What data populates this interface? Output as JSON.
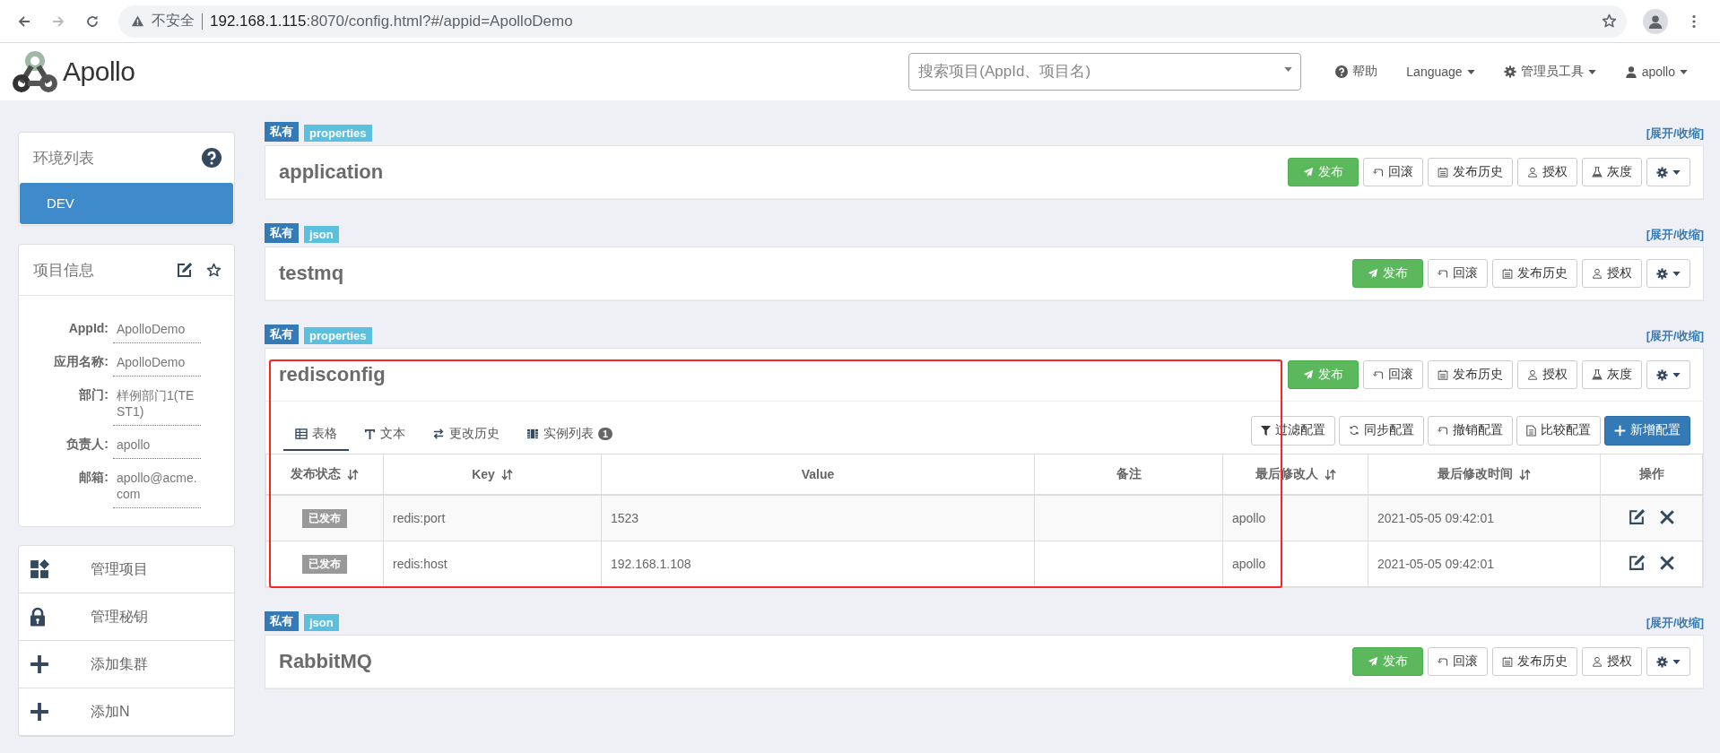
{
  "browser": {
    "warning": "不安全",
    "host": "192.168.1.115",
    "path": ":8070/config.html?#/appid=ApolloDemo"
  },
  "navbar": {
    "logo": "Apollo",
    "search": {
      "placeholder": "搜索项目(AppId、项目名)"
    },
    "links": [
      {
        "label": "帮助",
        "kind": "help",
        "caret": false
      },
      {
        "label": "Language",
        "kind": "plain",
        "caret": true
      },
      {
        "label": "管理员工具",
        "kind": "tools",
        "caret": true
      },
      {
        "label": "apollo",
        "kind": "user",
        "caret": true
      }
    ]
  },
  "sidebar": {
    "environments": {
      "title": "环境列表",
      "items": [
        {
          "label": "DEV",
          "selected": true
        }
      ]
    },
    "project": {
      "title": "项目信息",
      "fields": [
        {
          "label": "AppId:",
          "value": "ApolloDemo"
        },
        {
          "label": "应用名称:",
          "value": "ApolloDemo"
        },
        {
          "label": "部门:",
          "value": "样例部门1(TEST1)"
        },
        {
          "label": "负责人:",
          "value": "apollo"
        },
        {
          "label": "邮箱:",
          "value": "apollo@acme.com"
        }
      ]
    },
    "actions": [
      {
        "label": "管理项目",
        "kind": "manage"
      },
      {
        "label": "管理秘钥",
        "kind": "lock"
      },
      {
        "label": "添加集群",
        "kind": "add"
      },
      {
        "label": "添加N",
        "kind": "add"
      }
    ]
  },
  "namespaces": [
    {
      "tags": [
        {
          "label": "私有",
          "kind": "scope"
        },
        {
          "label": "properties",
          "kind": "format"
        }
      ],
      "toggle": "[展开/收缩]",
      "name": "application",
      "annotated": false,
      "buttons": [
        {
          "label": "发布",
          "kind": "publish"
        },
        {
          "label": "回滚",
          "kind": "rollback"
        },
        {
          "label": "发布历史",
          "kind": "history"
        },
        {
          "label": "授权",
          "kind": "grant"
        },
        {
          "label": "灰度",
          "kind": "gray"
        },
        {
          "kind": "settings"
        }
      ]
    },
    {
      "tags": [
        {
          "label": "私有",
          "kind": "scope"
        },
        {
          "label": "json",
          "kind": "format"
        }
      ],
      "toggle": "[展开/收缩]",
      "name": "testmq",
      "annotated": false,
      "buttons": [
        {
          "label": "发布",
          "kind": "publish"
        },
        {
          "label": "回滚",
          "kind": "rollback"
        },
        {
          "label": "发布历史",
          "kind": "history"
        },
        {
          "label": "授权",
          "kind": "grant"
        },
        {
          "kind": "settings"
        }
      ]
    },
    {
      "tags": [
        {
          "label": "私有",
          "kind": "scope"
        },
        {
          "label": "properties",
          "kind": "format"
        }
      ],
      "toggle": "[展开/收缩]",
      "name": "redisconfig",
      "annotated": true,
      "buttons": [
        {
          "label": "发布",
          "kind": "publish"
        },
        {
          "label": "回滚",
          "kind": "rollback"
        },
        {
          "label": "发布历史",
          "kind": "history"
        },
        {
          "label": "授权",
          "kind": "grant"
        },
        {
          "label": "灰度",
          "kind": "gray"
        },
        {
          "kind": "settings"
        }
      ],
      "tabs": [
        {
          "label": "表格",
          "kind": "table",
          "selected": true
        },
        {
          "label": "文本",
          "kind": "text",
          "selected": false
        },
        {
          "label": "更改历史",
          "kind": "history",
          "selected": false
        },
        {
          "label": "实例列表",
          "kind": "instances",
          "selected": false,
          "badge": "1"
        }
      ],
      "tools": [
        {
          "label": "过滤配置",
          "kind": "filter"
        },
        {
          "label": "同步配置",
          "kind": "sync"
        },
        {
          "label": "撤销配置",
          "kind": "revoke"
        },
        {
          "label": "比较配置",
          "kind": "compare"
        },
        {
          "label": "新增配置",
          "kind": "add"
        }
      ],
      "table": {
        "columns": [
          {
            "label": "发布状态",
            "sortable": true
          },
          {
            "label": "Key",
            "sortable": true
          },
          {
            "label": "Value",
            "sortable": false
          },
          {
            "label": "备注",
            "sortable": false
          },
          {
            "label": "最后修改人",
            "sortable": true
          },
          {
            "label": "最后修改时间",
            "sortable": true
          },
          {
            "label": "操作",
            "sortable": false
          }
        ],
        "rows": [
          {
            "status": "已发布",
            "key": "redis:port",
            "value": "1523",
            "modifier": "apollo",
            "modified": "2021-05-05 09:42:01"
          },
          {
            "status": "已发布",
            "key": "redis:host",
            "value": "192.168.1.108",
            "modifier": "apollo",
            "modified": "2021-05-05 09:42:01"
          }
        ]
      }
    },
    {
      "tags": [
        {
          "label": "私有",
          "kind": "scope"
        },
        {
          "label": "json",
          "kind": "format"
        }
      ],
      "toggle": "[展开/收缩]",
      "name": "RabbitMQ",
      "annotated": false,
      "buttons": [
        {
          "label": "发布",
          "kind": "publish"
        },
        {
          "label": "回滚",
          "kind": "rollback"
        },
        {
          "label": "发布历史",
          "kind": "history"
        },
        {
          "label": "授权",
          "kind": "grant"
        },
        {
          "kind": "settings"
        }
      ]
    }
  ]
}
